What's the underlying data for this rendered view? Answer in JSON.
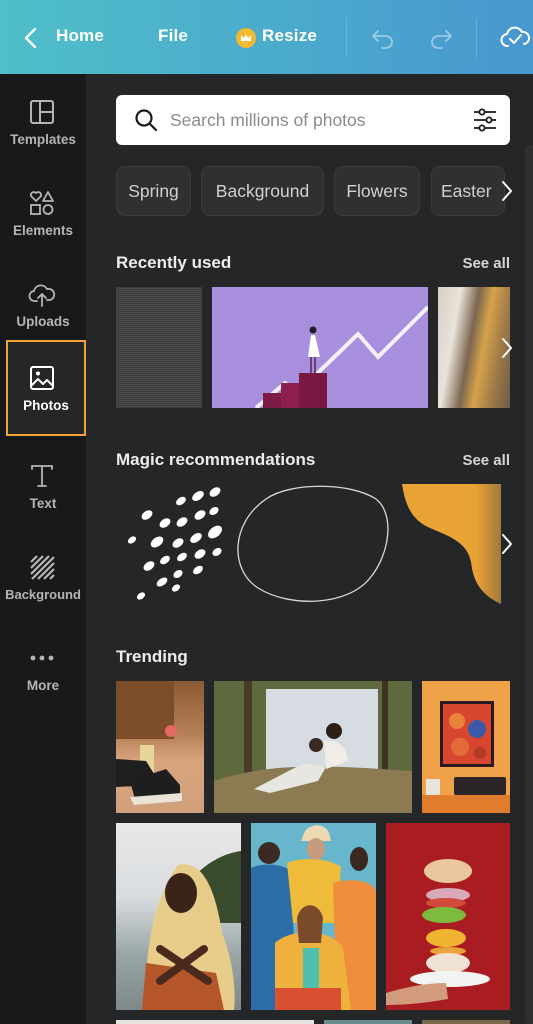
{
  "topbar": {
    "home_label": "Home",
    "file_label": "File",
    "resize_label": "Resize",
    "icons": [
      "back-chevron-icon",
      "crown-icon",
      "undo-icon",
      "redo-icon",
      "cloud-saved-icon"
    ]
  },
  "sidebar": {
    "items": [
      {
        "label": "Templates",
        "icon": "templates-icon"
      },
      {
        "label": "Elements",
        "icon": "elements-icon"
      },
      {
        "label": "Uploads",
        "icon": "upload-cloud-icon"
      },
      {
        "label": "Photos",
        "icon": "photo-icon",
        "active": true
      },
      {
        "label": "Text",
        "icon": "text-icon"
      },
      {
        "label": "Background",
        "icon": "background-hatch-icon"
      },
      {
        "label": "More",
        "icon": "more-dots-icon"
      }
    ],
    "active_color": "#f0a13a"
  },
  "search": {
    "placeholder": "Search millions of photos",
    "value": ""
  },
  "chips": [
    "Spring",
    "Background",
    "Flowers",
    "Easter"
  ],
  "sections": {
    "recently_used": {
      "title": "Recently used",
      "see_all": "See all",
      "items": [
        "dark texture",
        "woman on bar chart illustration",
        "person with yellow hair by window"
      ]
    },
    "magic": {
      "title": "Magic recommendations",
      "see_all": "See all",
      "items": [
        "white dots pattern",
        "hand-drawn blob outline",
        "orange wave shape"
      ]
    },
    "trending": {
      "title": "Trending",
      "items": [
        "sneakers with floral socks",
        "family by white sheet in forest",
        "record player and art on orange wall",
        "woman in yellow hijab",
        "group in colorful outfits",
        "floating burger on plate"
      ]
    }
  }
}
